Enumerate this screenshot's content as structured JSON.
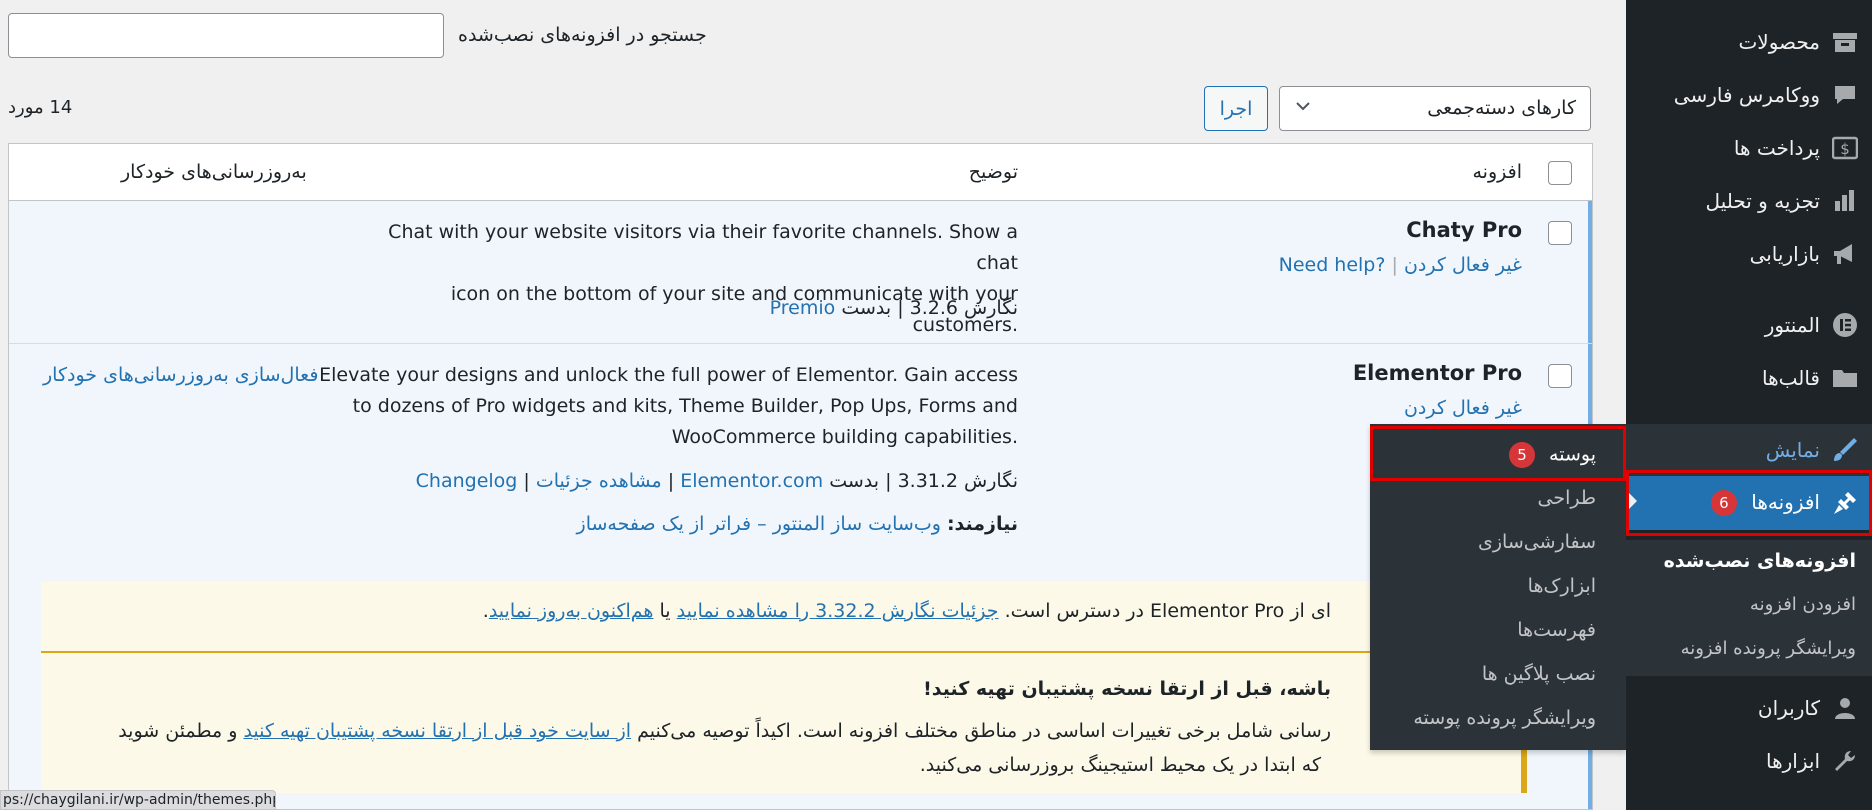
{
  "sidebar": {
    "items": [
      {
        "label": "محصولات",
        "icon": "archive-icon"
      },
      {
        "label": "ووکامرس فارسی",
        "icon": "chat-bubble-icon"
      },
      {
        "label": "پرداخت ها",
        "icon": "dollar-icon"
      },
      {
        "label": "تجزیه و تحلیل",
        "icon": "bar-chart-icon"
      },
      {
        "label": "بازاریابی",
        "icon": "megaphone-icon"
      },
      {
        "label": "المنتور",
        "icon": "elementor-icon"
      },
      {
        "label": "قالب‌ها",
        "icon": "folder-icon"
      },
      {
        "label": "نمایش",
        "icon": "paintbrush-icon"
      },
      {
        "label": "افزونه‌ها",
        "icon": "plugin-icon",
        "badge": "6"
      },
      {
        "label": "کاربران",
        "icon": "user-icon"
      },
      {
        "label": "ابزارها",
        "icon": "wrench-icon"
      }
    ],
    "submenu": [
      "افزونه‌های نصب‌شده",
      "افزودن افزونه",
      "ویرایشگر پرونده افزونه"
    ]
  },
  "flyout": {
    "items": [
      {
        "label": "پوسته",
        "badge": "5"
      },
      {
        "label": "طراحی"
      },
      {
        "label": "سفارشی‌سازی"
      },
      {
        "label": "ابزارک‌ها"
      },
      {
        "label": "فهرست‌ها"
      },
      {
        "label": "نصب پلاگین ها"
      },
      {
        "label": "ویرایشگر پرونده پوسته"
      }
    ]
  },
  "toolbar": {
    "search_label": "جستجو در افزونه‌های نصب‌شده",
    "search_value": "",
    "bulk_actions": "کارهای دسته‌جمعی",
    "apply": "اجرا",
    "count": "14 مورد"
  },
  "table": {
    "headers": {
      "plugin": "افزونه",
      "description": "توضیح",
      "auto_updates": "به‌روزرسانی‌های خودکار"
    },
    "rows": [
      {
        "name": "Chaty Pro",
        "actions": [
          "غیر فعال کردن",
          "Need help?"
        ],
        "description_lines": [
          "Chat with your website visitors via their favorite channels. Show a chat",
          "icon on the bottom of your site and communicate with your customers."
        ],
        "version": "نگارش 3.2.6",
        "by": "بدست",
        "author": "Premio"
      },
      {
        "name": "Elementor Pro",
        "actions": [
          "غیر فعال کردن"
        ],
        "auto_update_link": "فعال‌سازی به‌روزرسانی‌های خودکار",
        "description_lines": [
          "Elevate your designs and unlock the full power of Elementor. Gain access",
          "to dozens of Pro widgets and kits, Theme Builder, Pop Ups, Forms and",
          "WooCommerce building capabilities."
        ],
        "version": "نگارش 3.31.2",
        "by": "بدست",
        "author": "Elementor.com",
        "view_details": "مشاهده جزئیات",
        "changelog": "Changelog",
        "requires_label": "نیازمند:",
        "requires_value": "وب‌سایت ساز المنتور – فراتر از یک صفحه‌ساز"
      }
    ]
  },
  "update_notice": {
    "line_start": "ای از Elementor Pro در دسترس است.",
    "details_link": "جزئیات نگارش 3.32.2 را مشاهده نمایید",
    "or": "یا",
    "update_link": "هم‌اکنون به‌روز نمایید",
    "end": "."
  },
  "warning_notice": {
    "title": "باشه، قبل از ارتقا نسخه پشتیبان تهیه کنید!",
    "line1_start": "رسانی شامل برخی تغییرات اساسی در مناطق مختلف افزونه است. اکیداً توصیه می‌کنیم",
    "line1_link": "از سایت خود قبل از ارتقا نسخه پشتیبان تهیه کنید",
    "line1_end": "و مطمئن شوید",
    "line2": "که ابتدا در یک محیط استیجینگ بروزرسانی می‌کنید."
  },
  "status_bar": "ps://chaygilani.ir/wp-admin/themes.php",
  "colors": {
    "sidebar_bg": "#1d2327",
    "accent": "#2271b1",
    "badge": "#d63638",
    "highlight": "#e10000",
    "notice_bg": "#fcf9e8",
    "warning_border": "#dba617"
  }
}
